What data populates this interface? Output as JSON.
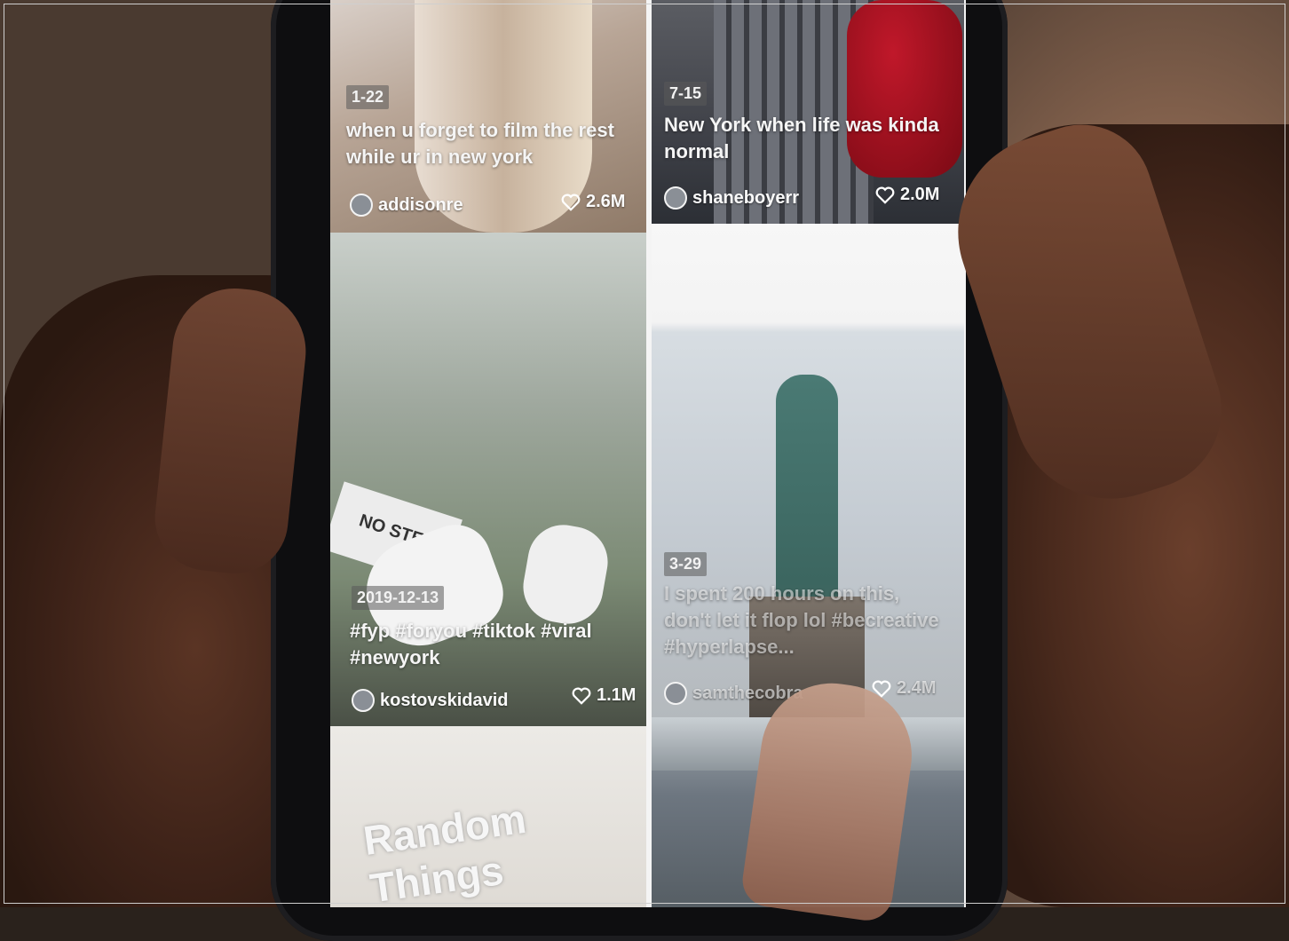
{
  "feed": {
    "videos": [
      {
        "date": "1-22",
        "caption": "when u forget to film the rest while ur in new york",
        "author": "addisonre",
        "likes": "2.6M"
      },
      {
        "date": "7-15",
        "caption": "New York when life was kinda normal",
        "author": "shaneboyerr",
        "likes": "2.0M"
      },
      {
        "date": "2019-12-13",
        "caption": "#fyp #foryou #tiktok #viral #newyork",
        "author": "kostovskidavid",
        "likes": "1.1M"
      },
      {
        "date": "3-29",
        "caption": "I spent 200 hours on this, don't let it flop lol #becreative #hyperlapse...",
        "author": "samthecobra",
        "likes": "2.4M"
      },
      {
        "overlay_text": "Random Things"
      }
    ]
  },
  "icons": {
    "like": "heart-icon",
    "avatar": "user-avatar-icon"
  },
  "colors": {
    "overlay_text": "#f5f5f5",
    "date_badge": "#5a5a5a"
  }
}
